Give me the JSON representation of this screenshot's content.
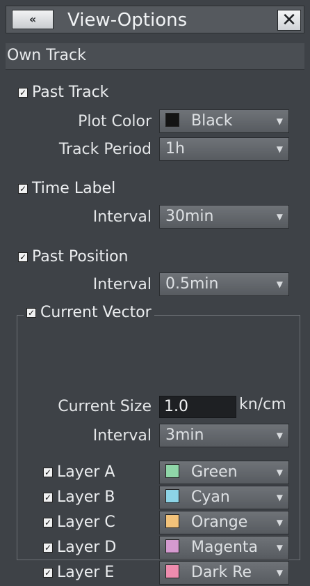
{
  "window": {
    "title": "View-Options",
    "collapse_label": "«",
    "close_label": "✕"
  },
  "section": {
    "title": "Own Track"
  },
  "past_track": {
    "label": "Past Track",
    "checked": true,
    "plot_color_label": "Plot Color",
    "plot_color_value": "Black",
    "plot_color_swatch": "#141414",
    "track_period_label": "Track Period",
    "track_period_value": "1h"
  },
  "time_label": {
    "label": "Time Label",
    "checked": true,
    "interval_label": "Interval",
    "interval_value": "30min"
  },
  "past_position": {
    "label": "Past Position",
    "checked": true,
    "interval_label": "Interval",
    "interval_value": "0.5min"
  },
  "current_vector": {
    "label": "Current Vector",
    "checked": true,
    "size_label": "Current Size",
    "size_value": "1.0",
    "size_unit": "kn/cm",
    "interval_label": "Interval",
    "interval_value": "3min",
    "layers": [
      {
        "label": "Layer A",
        "checked": true,
        "color": "Green",
        "swatch": "#8fd6a8"
      },
      {
        "label": "Layer B",
        "checked": true,
        "color": "Cyan",
        "swatch": "#8dd4e6"
      },
      {
        "label": "Layer C",
        "checked": true,
        "color": "Orange",
        "swatch": "#f2c27a"
      },
      {
        "label": "Layer D",
        "checked": true,
        "color": "Magenta",
        "swatch": "#d59ad0"
      },
      {
        "label": "Layer E",
        "checked": true,
        "color": "Dark Re",
        "swatch": "#ee8cae"
      }
    ]
  },
  "icons": {
    "dropdown_arrow": "chevron-down",
    "check": "checkmark"
  }
}
